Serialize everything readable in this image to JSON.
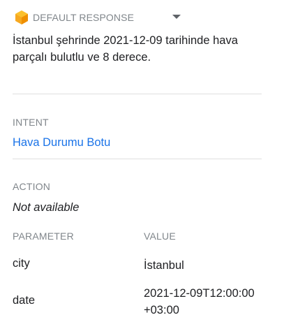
{
  "response": {
    "title": "DEFAULT RESPONSE",
    "text": "İstanbul şehrinde 2021-12-09 tarihinde hava parçalı bulutlu ve 8 derece."
  },
  "intent": {
    "label": "INTENT",
    "value": "Hava Durumu Botu"
  },
  "action": {
    "label": "ACTION",
    "value": "Not available"
  },
  "parameters": {
    "header_parameter": "PARAMETER",
    "header_value": "VALUE",
    "rows": [
      {
        "name": "city",
        "value": "İstanbul"
      },
      {
        "name": "date",
        "value": "2021-12-09T12:00:00+03:00"
      }
    ]
  },
  "colors": {
    "icon": "#f6a821",
    "link": "#1a73e8",
    "muted": "#80868b"
  },
  "icons": {
    "response": "dialogflow-cube-icon",
    "dropdown": "chevron-down-icon"
  }
}
